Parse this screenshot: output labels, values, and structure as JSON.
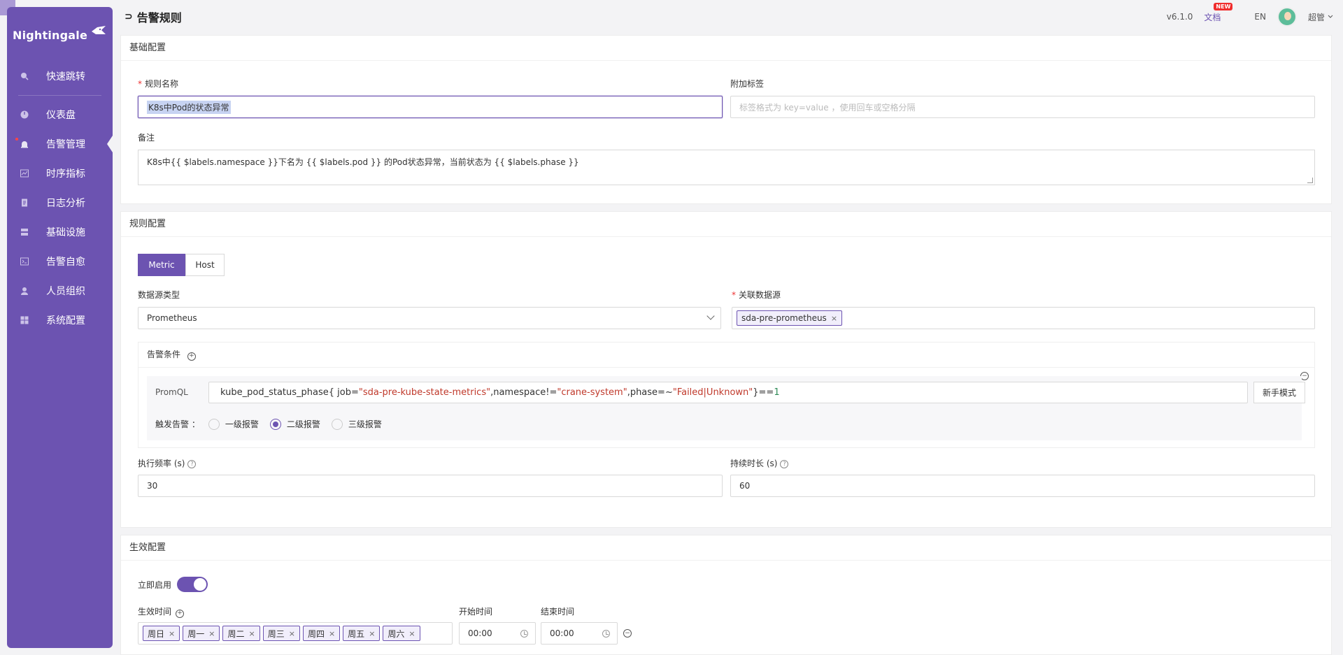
{
  "sidebar": {
    "brand": "Nightingale",
    "items": [
      {
        "label": "快速跳转",
        "icon": "search-icon"
      },
      {
        "label": "仪表盘",
        "icon": "dashboard-icon"
      },
      {
        "label": "告警管理",
        "icon": "alarm-bell-icon"
      },
      {
        "label": "时序指标",
        "icon": "line-chart-icon"
      },
      {
        "label": "日志分析",
        "icon": "document-icon"
      },
      {
        "label": "基础设施",
        "icon": "server-icon"
      },
      {
        "label": "告警自愈",
        "icon": "terminal-icon"
      },
      {
        "label": "人员组织",
        "icon": "user-icon"
      },
      {
        "label": "系统配置",
        "icon": "grid-icon"
      }
    ]
  },
  "header": {
    "title": "告警规则",
    "version": "v6.1.0",
    "docs": "文档",
    "new_badge": "NEW",
    "lang": "EN",
    "user": "超管"
  },
  "basic": {
    "title": "基础配置",
    "rule_name_label": "规则名称",
    "rule_name_value": "K8s中Pod的状态异常",
    "tags_label": "附加标签",
    "tags_placeholder": "标签格式为 key=value ，使用回车或空格分隔",
    "note_label": "备注",
    "note_value": "K8s中{{ $labels.namespace }}下名为 {{ $labels.pod }} 的Pod状态异常，当前状态为 {{ $labels.phase }}"
  },
  "rule": {
    "title": "规则配置",
    "tabs": [
      "Metric",
      "Host"
    ],
    "ds_type_label": "数据源类型",
    "ds_type_value": "Prometheus",
    "ds_label": "关联数据源",
    "ds_tags": [
      "sda-pre-prometheus"
    ],
    "condition_label": "告警条件",
    "promql_label": "PromQL",
    "promql": {
      "metric": "kube_pod_status_phase{ job=",
      "job": "\"sda-pre-kube-state-metrics\"",
      "ns_key": ",namespace!=",
      "ns": "\"crane-system\"",
      "phase_key": ",phase=~",
      "phase": "\"Failed|Unknown\"",
      "op": "}==",
      "threshold": "1"
    },
    "novice_mode": "新手模式",
    "trigger_label": "触发告警 ：",
    "levels": [
      "一级报警",
      "二级报警",
      "三级报警"
    ],
    "selected_level": "二级报警",
    "freq_label": "执行频率 (s)",
    "freq_value": "30",
    "duration_label": "持续时长 (s)",
    "duration_value": "60"
  },
  "effective": {
    "title": "生效配置",
    "enable_label": "立即启用",
    "enabled": true,
    "time_label": "生效时间",
    "days": [
      "周日",
      "周一",
      "周二",
      "周三",
      "周四",
      "周五",
      "周六"
    ],
    "start_label": "开始时间",
    "start_value": "00:00",
    "end_label": "结束时间",
    "end_value": "00:00"
  }
}
